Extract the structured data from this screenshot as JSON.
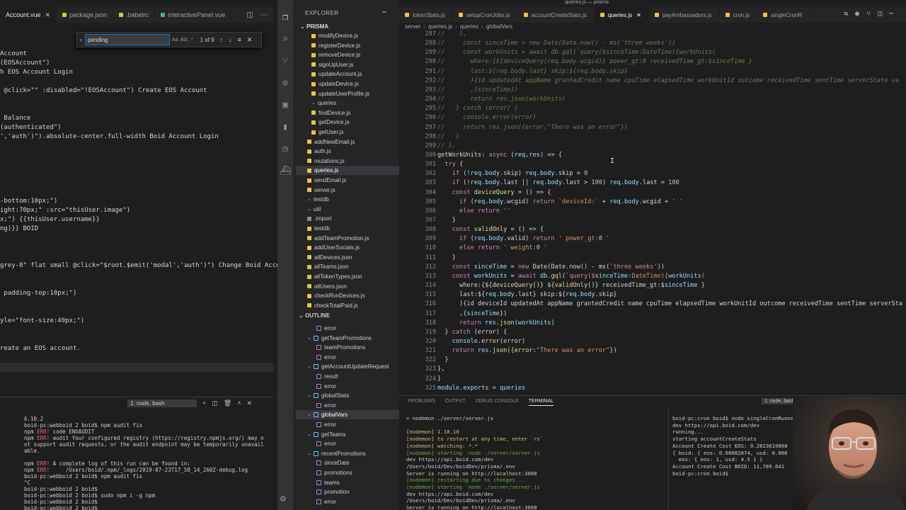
{
  "window_title": "queries.js — prisma",
  "left_editor": {
    "tabs": [
      {
        "label": "Account.vue",
        "color": "#41b883",
        "active": true
      },
      {
        "label": "package.json",
        "color": "#cbcb41",
        "active": false
      },
      {
        "label": ".babelrc",
        "color": "#cbcb41",
        "active": false
      },
      {
        "label": "interactivePanel.vue",
        "color": "#41b883",
        "active": false
      }
    ],
    "find": {
      "value": "pending",
      "opt_case": "Aa",
      "opt_word": "Ab|",
      "opt_regex": ".*",
      "count": "1 of 9"
    },
    "code_lines": [
      "Account",
      "(EOSAccount\")",
      "h EOS Account Login",
      "",
      " @click=\"\" :disabled=\"!EOSAccount\") Create EOS Account",
      "",
      "",
      " Balance",
      "(authenticated\")",
      "','auth')\").absolute-center.full-width Boid Account Login",
      "",
      "",
      "",
      "",
      "",
      "",
      "-bottom:10px;\")",
      "ight:70px;\" :src=\"thisUser.image\")",
      "x;\") {{thisUser.username}}",
      "ng)}} BOID",
      "",
      "",
      "",
      "grey-8\" flat small @click=\"$root.$emit('modal','auth')\") Change Boid Accou",
      "",
      "",
      " padding-top:10px;\")",
      "",
      "",
      "yle=\"font-size:40px;\")",
      "",
      "",
      "reate an EOS account.",
      "",
      "",
      "",
      "",
      "",
      "",
      "yle=\"font-size:20px;\")",
      "",
      "",
      " enough ",
      "",
      " @click=\"openCreateAccountModal()\") Create EOS Account"
    ],
    "pending_line_prefix": " enough ",
    "pending_word": "pending",
    "pending_line_suffix": " BOID to create an EOS account."
  },
  "left_terminal": {
    "selector": "1: node, bash",
    "lines": [
      "6.10.2",
      "boid-pc:webboid 2 boid$ npm audit fix",
      "npm ERR! code ENOAUDIT",
      "npm ERR! audit Your configured registry (https://registry.npmjs.org/) may n",
      "ot support audit requests, or the audit endpoint may be temporarily unavail",
      "able.",
      "",
      "npm ERR! A complete log of this run can be found in:",
      "npm ERR!     /Users/boid/.npm/_logs/2019-07-23T17_58_14_260Z-debug.log",
      "boid-pc:webboid 2 boid$ npm audit fix",
      "^C",
      "boid-pc:webboid 2 boid$",
      "boid-pc:webboid 2 boid$ sudo npm i -g npm",
      "boid-pc:webboid 2 boid$",
      "boid-pc:webboid 2 boid$"
    ]
  },
  "sidebar": {
    "title": "EXPLORER",
    "root": "PRISMA",
    "files_top": [
      "modifyDevice.js",
      "registerDevice.js",
      "removeDevice.js",
      "signUpUser.js",
      "updateAccount.js",
      "updateDevice.js",
      "updateUserProfile.js"
    ],
    "queries_folder": "queries",
    "queries_files": [
      "findDevice.js",
      "getDevice.js",
      "getUser.js"
    ],
    "files_mid": [
      "addNewEmail.js",
      "auth.js",
      "mutations.js",
      "queries.js",
      "sendEmail.js",
      "server.js"
    ],
    "testdb": "testdb",
    "util": "util",
    "util_items": [
      ".import",
      "testdb",
      "addTeamPromotion.js",
      "addUserSocials.js",
      "allDevices.json",
      "allTeams.json",
      "allTokenTypes.json",
      "allUsers.json",
      "checkRvnDevices.js",
      "checkTotalPaid.js"
    ],
    "outline_title": "OUTLINE",
    "outline": [
      {
        "label": "error",
        "depth": 3,
        "kind": "var"
      },
      {
        "label": "getTeamPromotions",
        "depth": 2,
        "kind": "fn",
        "chev": true
      },
      {
        "label": "teamPromotions",
        "depth": 3,
        "kind": "var"
      },
      {
        "label": "error",
        "depth": 3,
        "kind": "var"
      },
      {
        "label": "getAccountUpdateRequest",
        "depth": 2,
        "kind": "fn",
        "chev": true
      },
      {
        "label": "result",
        "depth": 3,
        "kind": "var"
      },
      {
        "label": "error",
        "depth": 3,
        "kind": "var"
      },
      {
        "label": "globalStats",
        "depth": 2,
        "kind": "fn",
        "chev": true
      },
      {
        "label": "error",
        "depth": 3,
        "kind": "var"
      },
      {
        "label": "globalVars",
        "depth": 2,
        "kind": "fn",
        "chev": true,
        "sel": true
      },
      {
        "label": "error",
        "depth": 3,
        "kind": "var"
      },
      {
        "label": "getTeams",
        "depth": 2,
        "kind": "fn",
        "chev": true
      },
      {
        "label": "error",
        "depth": 3,
        "kind": "var"
      },
      {
        "label": "recentPromotions",
        "depth": 2,
        "kind": "fn",
        "chev": true
      },
      {
        "label": "sinceDate",
        "depth": 3,
        "kind": "var"
      },
      {
        "label": "promotions",
        "depth": 3,
        "kind": "var"
      },
      {
        "label": "teams",
        "depth": 3,
        "kind": "var"
      },
      {
        "label": "promotion",
        "depth": 3,
        "kind": "var"
      },
      {
        "label": "error",
        "depth": 3,
        "kind": "var"
      }
    ]
  },
  "right_editor": {
    "tabs": [
      {
        "label": "tokenStats.js",
        "active": false
      },
      {
        "label": "setupCronJobs.js",
        "active": false
      },
      {
        "label": "accountCreateStats.js",
        "active": false
      },
      {
        "label": "queries.js",
        "active": true
      },
      {
        "label": "payAmbassadors.js",
        "active": false
      },
      {
        "label": "cron.js",
        "active": false
      },
      {
        "label": "singleCronR",
        "active": false
      }
    ],
    "breadcrumb": [
      "server",
      "queries.js",
      "queries",
      "globalVars"
    ],
    "first_line_number": 287,
    "lines": [
      "//    },",
      "//     const sinceTime = new Date(Date.now() - ms('three weeks'))",
      "//     const workUnits = await db.gql(`query($sinceTime:DateTime){workUnits(",
      "//       where:{${deviceQuery(req.body.wcgid)} power_gt:0 receivedTime_gt:$sinceTime }",
      "//       last:${req.body.last} skip:${req.body.skip}",
      "//       ){id updatedAt appName grantedCredit name cpuTime elapsedTime workUnitId outcome receivedTime sentTime serverState va",
      "//       ,{sinceTime})",
      "//       return res.json(workUnits)",
      "//   } catch (error) {",
      "//     console.error(error)",
      "//     return res.json({error:\"There was an error\"})",
      "//   }",
      "// },",
      "getWorkUnits: async (req,res) => {",
      "  try {",
      "    if (!req.body.skip) req.body.skip = 0",
      "    if (!req.body.last || req.body.last > 100) req.body.last = 100",
      "    const deviceQuery = () => {",
      "      if (req.body.wcgid) return `deviceId:` + req.body.wcgid + ' '",
      "      else return ''",
      "    }",
      "    const validOnly = () => {",
      "      if (req.body.valid) return ' power_gt:0 '",
      "      else return ' weight:0 '",
      "    }",
      "    const sinceTime = new Date(Date.now() - ms('three weeks'))",
      "    const workUnits = await db.gql(`query($sinceTime:DateTime){workUnits(",
      "      where:{${deviceQuery()} ${validOnly()} receivedTime_gt:$sinceTime }",
      "      last:${req.body.last} skip:${req.body.skip}",
      "      ){id deviceId updatedAt appName grantedCredit name cpuTime elapsedTime workUnitId outcome receivedTime sentTime serverSta",
      "      ,{sinceTime})",
      "      return res.json(workUnits)",
      "  } catch (error) {",
      "    console.error(error)",
      "    return res.json({error:\"There was an error\"})",
      "  }",
      "},",
      "}",
      "module.exports = queries"
    ]
  },
  "panel": {
    "tabs": [
      "PROBLEMS",
      "OUTPUT",
      "DEBUG CONSOLE",
      "TERMINAL"
    ],
    "active_tab": "TERMINAL",
    "selector": "1: node, bash",
    "term1": [
      "> nodemon ./server/server.js",
      "",
      "[nodemon] 1.18.10",
      "[nodemon] to restart at any time, enter `rs`",
      "[nodemon] watching: *.*",
      "[nodemon] starting `node ./server/server.js`",
      "dev https://api.boid.com/dev",
      "/Users/boid/Dev/boidDev/prisma/.env",
      "Server is running on http://localhost:3000",
      "[nodemon] restarting due to changes...",
      "[nodemon] starting `node ./server/server.js`",
      "dev https://api.boid.com/dev",
      "/Users/boid/Dev/boidDev/prisma/.env",
      "Server is running on http://localhost:3000"
    ],
    "term2": [
      "boid-pc:cron boid$ node singleCronRunner",
      "dev https://api.boid.com/dev",
      "running...",
      "starting accountCreateStats",
      "Account Create Cost EOS: 0.2823619068",
      "{ boid: { eos: 0.00082874, usd: 0.000",
      "  eos: { eos: 1, usd: 4.5 } }",
      "Account Create Cost BOID: 11,789.641",
      "boid-pc:cron boid$"
    ]
  }
}
